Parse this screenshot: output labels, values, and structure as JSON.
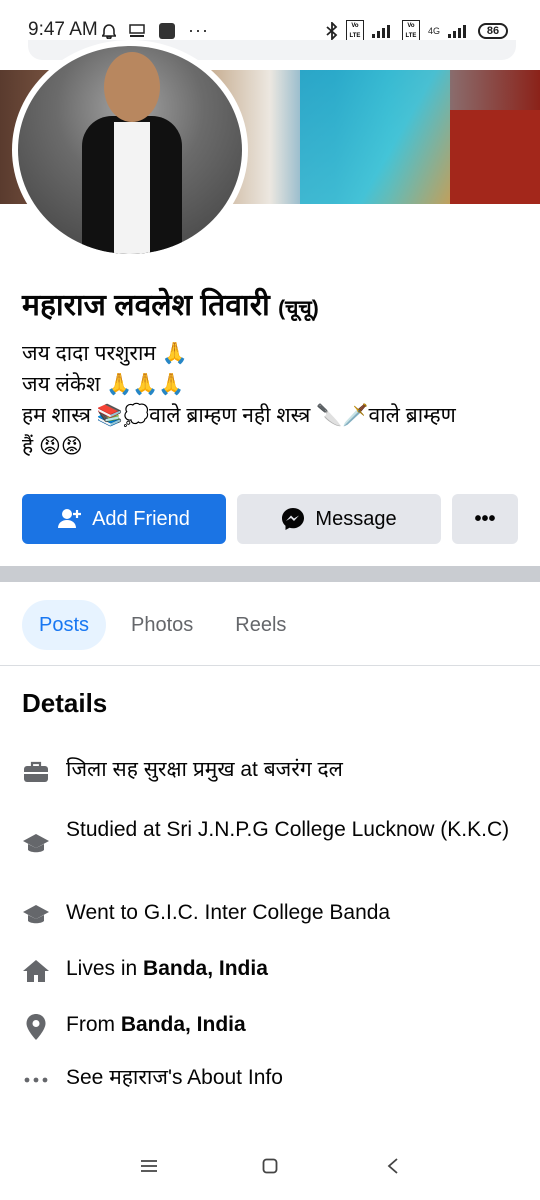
{
  "status_bar": {
    "time": "9:47 AM",
    "battery": "86",
    "network": "4G",
    "lte": "Vo LTE"
  },
  "profile": {
    "name": "महाराज लवलेश तिवारी",
    "nickname": "(चूचू)",
    "bio_lines": [
      "जय दादा परशुराम 🙏",
      "जय लंकेश 🙏🙏🙏",
      "हम शास्त्र 📚💭वाले ब्राम्हण नही शस्त्र 🔪🗡️वाले ब्राम्हण",
      "हैं 😡😡"
    ]
  },
  "actions": {
    "add_friend": "Add Friend",
    "message": "Message",
    "more": "•••"
  },
  "tabs": [
    {
      "label": "Posts",
      "active": true
    },
    {
      "label": "Photos",
      "active": false
    },
    {
      "label": "Reels",
      "active": false
    }
  ],
  "details": {
    "title": "Details",
    "work": "जिला सह सुरक्षा प्रमुख at बजरंग दल",
    "study1": "Studied at Sri J.N.P.G College Lucknow (K.K.C)",
    "study2": "Went to G.I.C. Inter College Banda",
    "lives_prefix": "Lives in ",
    "lives_place": "Banda, India",
    "from_prefix": "From ",
    "from_place": "Banda, India",
    "about": "See महाराज's About Info"
  },
  "colors": {
    "primary": "#1b74e4",
    "secondary_bg": "#e4e6eb",
    "active_tab_bg": "#e7f3ff",
    "divider": "#c9ccd1"
  }
}
